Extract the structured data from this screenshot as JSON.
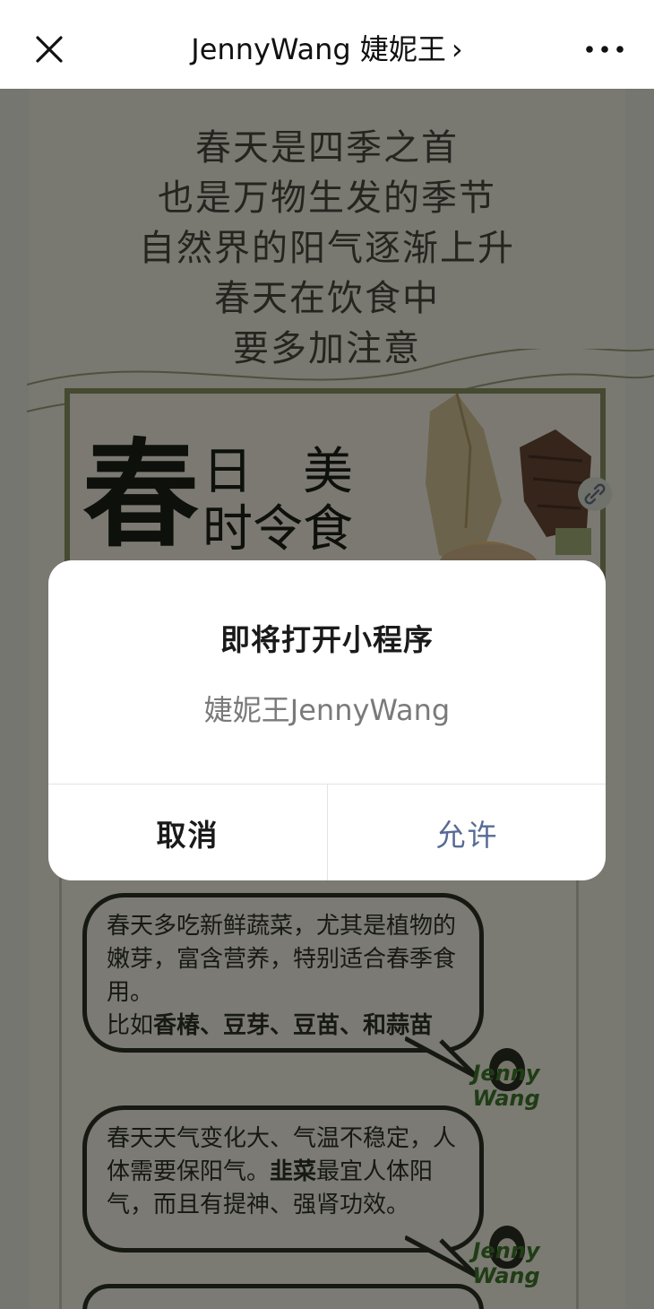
{
  "nav": {
    "title": "JennyWang 婕妮王",
    "title_chevron": "›",
    "close_icon": "close-icon",
    "more_icon": "more-icon"
  },
  "article": {
    "intro_lines": [
      "春天是四季之首",
      "也是万物生发的季节",
      "自然界的阳气逐渐上升",
      "春天在饮食中",
      "要多加注意"
    ],
    "banner": {
      "big_char": "春",
      "words": [
        "日",
        "美",
        "时令",
        "食"
      ]
    },
    "bubbles": [
      {
        "text_before": "春天多吃新鲜蔬菜，尤其是植物的嫩芽，富含营养，特别适合春季食用。",
        "text_line2_prefix": "比如",
        "text_bold": "香椿、豆芽、豆苗、和蒜苗",
        "signature": "Jenny Wang"
      },
      {
        "text_before": "春天天气变化大、气温不稳定，人体需要保阳气。",
        "text_bold": "韭菜",
        "text_after": "最宜人体阳气，而且有提神、强肾功效。",
        "signature": "Jenny Wang"
      }
    ]
  },
  "dialog": {
    "title": "即将打开小程序",
    "app_name": "婕妮王JennyWang",
    "cancel_label": "取消",
    "allow_label": "允许"
  },
  "colors": {
    "allow_text": "#576b95",
    "overlay": "rgba(0,0,0,0.5)",
    "banner_border": "#8a9560",
    "signature_green": "#3e7a2a"
  }
}
